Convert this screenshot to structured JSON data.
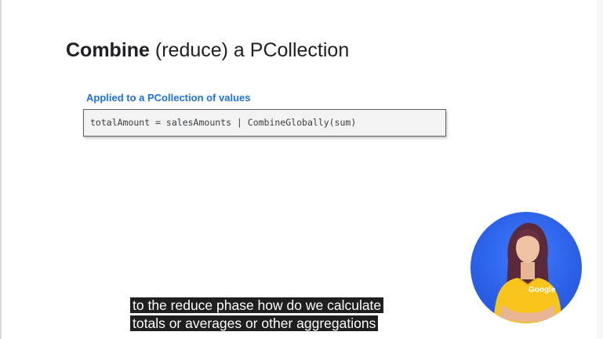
{
  "slide": {
    "title_bold": "Combine",
    "title_rest": " (reduce) a PCollection",
    "section_label": "Applied to a PCollection of values",
    "code_line": "totalAmount = salesAmounts | CombineGlobally(sum)"
  },
  "captions": {
    "line1": "to the reduce phase how do we calculate",
    "line2": "totals or averages or other aggregations"
  },
  "presenter": {
    "shirt_text": "Google"
  },
  "colors": {
    "accent_blue": "#1a73e8",
    "presenter_bg": "#2a5fe6",
    "shirt_yellow": "#f9c51b"
  }
}
